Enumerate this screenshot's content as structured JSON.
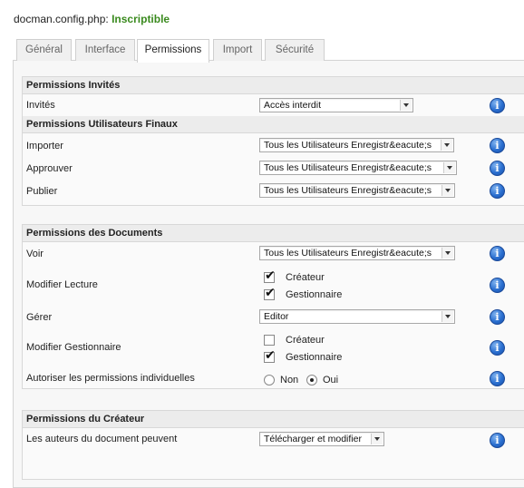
{
  "header": {
    "file": "docman.config.php:",
    "status": "Inscriptible"
  },
  "tabs": [
    "Général",
    "Interface",
    "Permissions",
    "Import",
    "Sécurité"
  ],
  "guests": {
    "title": "Permissions Invités",
    "label": "Invités",
    "value": "Accès interdit"
  },
  "final_users": {
    "title": "Permissions Utilisateurs Finaux",
    "import_label": "Importer",
    "approve_label": "Approuver",
    "publish_label": "Publier",
    "option": "Tous les Utilisateurs Enregistr&eacute;s"
  },
  "documents": {
    "title": "Permissions des Documents",
    "view_label": "Voir",
    "view_value": "Tous les Utilisateurs Enregistr&eacute;s",
    "edit_read_label": "Modifier Lecture",
    "manage_label": "Gérer",
    "manage_value": "Editor",
    "edit_manager_label": "Modifier Gestionnaire",
    "individual_label": "Autoriser les permissions individuelles",
    "creator": "Créateur",
    "manager": "Gestionnaire",
    "no": "Non",
    "yes": "Oui"
  },
  "creator": {
    "title": "Permissions du Créateur",
    "authors_label": "Les auteurs du document peuvent",
    "authors_value": "Télécharger et modifier"
  },
  "icons": {
    "info": "i"
  },
  "colors": {
    "status": "#3a8a1e",
    "info": "#2a6fd0"
  }
}
